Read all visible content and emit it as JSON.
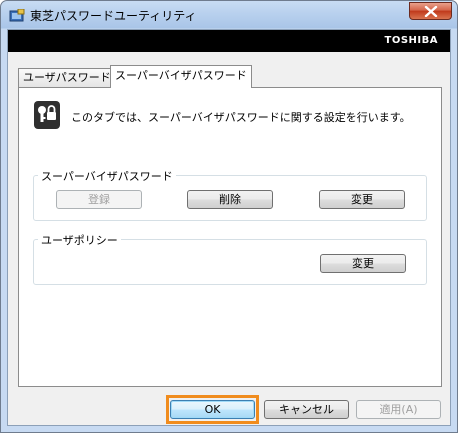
{
  "window": {
    "title": "東芝パスワードユーティリティ"
  },
  "brand": {
    "text": "TOSHIBA"
  },
  "tabs": [
    {
      "label": "ユーザパスワード"
    },
    {
      "label": "スーパーバイザパスワード"
    }
  ],
  "info": {
    "text": "このタブでは、スーパーバイザパスワードに関する設定を行います。"
  },
  "supervisor_group": {
    "label": "スーパーバイザパスワード",
    "register_label": "登録",
    "delete_label": "削除",
    "change_label": "変更"
  },
  "policy_group": {
    "label": "ユーザポリシー",
    "change_label": "変更"
  },
  "footer": {
    "ok_label": "OK",
    "cancel_label": "キャンセル",
    "apply_label": "適用(A)"
  },
  "colors": {
    "highlight": "#f08c1e",
    "close_button": "#c0391b",
    "brand_bar": "#000000"
  }
}
